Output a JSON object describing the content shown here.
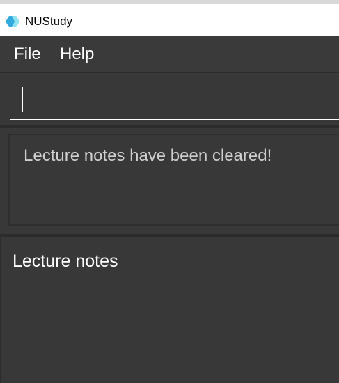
{
  "window": {
    "title": "NUStudy",
    "icon": "app-logo-icon"
  },
  "menu": {
    "items": [
      {
        "label": "File"
      },
      {
        "label": "Help"
      }
    ]
  },
  "command_box": {
    "value": ""
  },
  "result_display": {
    "text": "Lecture notes have been cleared!"
  },
  "list_panel": {
    "title": "Lecture notes",
    "items": []
  },
  "colors": {
    "background": "#383838",
    "title_bar": "#ffffff",
    "text": "#ffffff",
    "result_text": "#cfcfcf",
    "logo_primary": "#33aadd",
    "logo_secondary": "#66ddee"
  }
}
